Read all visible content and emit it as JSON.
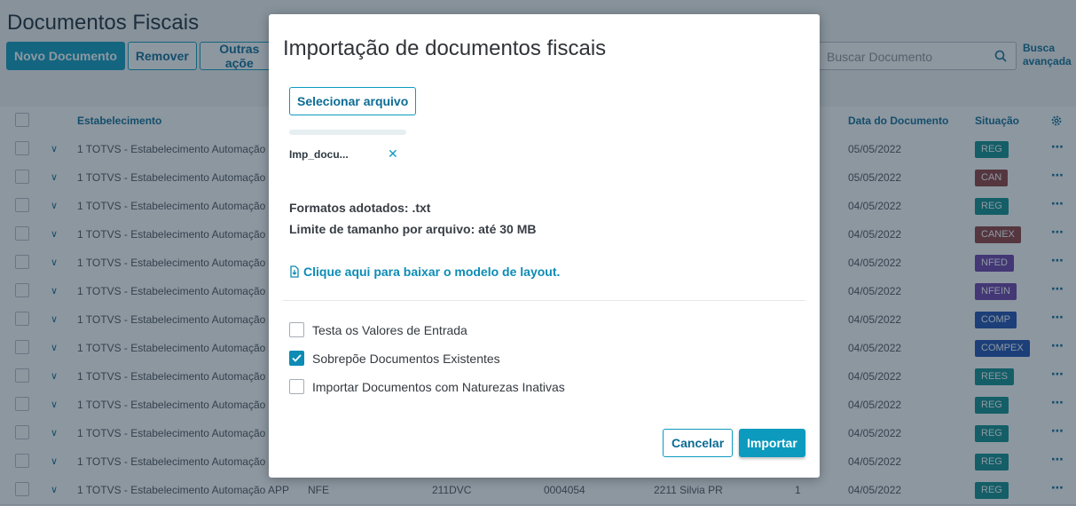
{
  "page": {
    "title": "Documentos Fiscais",
    "toolbar": {
      "new_label": "Novo Documento",
      "remove_label": "Remover",
      "other_label": "Outras açõe"
    },
    "search": {
      "placeholder": "Buscar Documento",
      "advanced_label_1": "Busca",
      "advanced_label_2": "avançada"
    },
    "columns": {
      "establishment": "Estabelecimento",
      "doc_date": "Data do Documento",
      "situation": "Situação"
    },
    "rows": [
      {
        "establishment": "1 TOTVS - Estabelecimento Automação",
        "date": "05/05/2022",
        "tag": "REG",
        "tag_color": "#0d8c8c"
      },
      {
        "establishment": "1 TOTVS - Estabelecimento Automação",
        "date": "05/05/2022",
        "tag": "CAN",
        "tag_color": "#8e3d3d"
      },
      {
        "establishment": "1 TOTVS - Estabelecimento Automação",
        "date": "04/05/2022",
        "tag": "REG",
        "tag_color": "#0d8c8c"
      },
      {
        "establishment": "1 TOTVS - Estabelecimento Automação",
        "date": "04/05/2022",
        "tag": "CANEX",
        "tag_color": "#8e3d3d"
      },
      {
        "establishment": "1 TOTVS - Estabelecimento Automação",
        "date": "04/05/2022",
        "tag": "NFED",
        "tag_color": "#6a3fa8"
      },
      {
        "establishment": "1 TOTVS - Estabelecimento Automação",
        "date": "04/05/2022",
        "tag": "NFEIN",
        "tag_color": "#6a3fa8"
      },
      {
        "establishment": "1 TOTVS - Estabelecimento Automação",
        "date": "04/05/2022",
        "tag": "COMP",
        "tag_color": "#1d4fb0"
      },
      {
        "establishment": "1 TOTVS - Estabelecimento Automação",
        "date": "04/05/2022",
        "tag": "COMPEX",
        "tag_color": "#1d4fb0"
      },
      {
        "establishment": "1 TOTVS - Estabelecimento Automação",
        "date": "04/05/2022",
        "tag": "REES",
        "tag_color": "#0d8c8c"
      },
      {
        "establishment": "1 TOTVS - Estabelecimento Automação",
        "date": "04/05/2022",
        "tag": "REG",
        "tag_color": "#0d8c8c"
      },
      {
        "establishment": "1 TOTVS - Estabelecimento Automação",
        "date": "04/05/2022",
        "tag": "REG",
        "tag_color": "#0d8c8c"
      },
      {
        "establishment": "1 TOTVS - Estabelecimento Automação",
        "date": "04/05/2022",
        "tag": "REG",
        "tag_color": "#0d8c8c"
      },
      {
        "establishment": "1 TOTVS - Estabelecimento Automação APP",
        "type": "NFE",
        "series": "211DVC",
        "number": "0004054",
        "participant": "2211 Silvia PR",
        "qty": "1",
        "date": "04/05/2022",
        "tag": "REG",
        "tag_color": "#0d8c8c"
      }
    ]
  },
  "modal": {
    "title": "Importação de documentos fiscais",
    "select_file_label": "Selecionar arquivo",
    "file_name": "Imp_docu...",
    "formats_label": "Formatos adotados: .txt",
    "size_limit_label": "Limite de tamanho por arquivo: até 30 MB",
    "download_link": "Clique aqui para baixar o modelo de layout.",
    "options": [
      {
        "label": "Testa os Valores de Entrada",
        "checked": false
      },
      {
        "label": "Sobrepõe Documentos Existentes",
        "checked": true
      },
      {
        "label": "Importar Documentos com Naturezas Inativas",
        "checked": false
      }
    ],
    "cancel_label": "Cancelar",
    "import_label": "Importar"
  }
}
